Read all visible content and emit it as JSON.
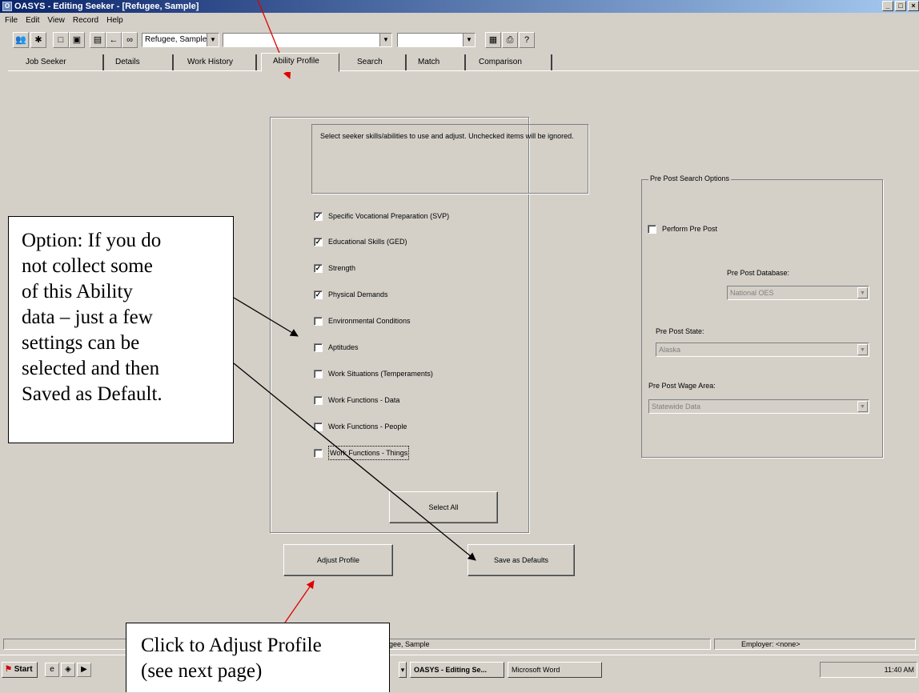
{
  "window": {
    "title": "OASYS - Editing Seeker - [Refugee, Sample]",
    "controls": [
      "_",
      "□",
      "×"
    ]
  },
  "menu": [
    "File",
    "Edit",
    "View",
    "Record",
    "Help"
  ],
  "toolbar": {
    "seeker_combo": "Refugee, Sample",
    "combo2": "",
    "combo3": ""
  },
  "tabs": [
    {
      "label": "Job Seeker"
    },
    {
      "label": "Details"
    },
    {
      "label": "Work History"
    },
    {
      "label": "Ability Profile"
    },
    {
      "label": "Search"
    },
    {
      "label": "Match"
    },
    {
      "label": "Comparison"
    }
  ],
  "instructions": "Select seeker skills/abilities to use and adjust.  Unchecked items will be ignored.",
  "checkboxes": [
    {
      "label": "Specific Vocational Preparation (SVP)",
      "checked": true
    },
    {
      "label": "Educational Skills (GED)",
      "checked": true
    },
    {
      "label": "Strength",
      "checked": true
    },
    {
      "label": "Physical Demands",
      "checked": true
    },
    {
      "label": "Environmental Conditions",
      "checked": false
    },
    {
      "label": "Aptitudes",
      "checked": false
    },
    {
      "label": "Work Situations (Temperaments)",
      "checked": false
    },
    {
      "label": "Work Functions - Data",
      "checked": false
    },
    {
      "label": "Work Functions - People",
      "checked": false
    },
    {
      "label": "Work Functions - Things",
      "checked": false
    }
  ],
  "buttons": {
    "select_all": "Select All",
    "adjust_profile": "Adjust Profile",
    "save_defaults": "Save as Defaults"
  },
  "prepost": {
    "group_label": "Pre Post Search Options",
    "perform_label": "Perform Pre Post",
    "perform_checked": false,
    "db_label": "Pre Post Database:",
    "db_value": "National OES",
    "state_label": "Pre Post State:",
    "state_value": "Alaska",
    "wage_label": "Pre Post Wage Area:",
    "wage_value": "Statewide Data"
  },
  "statusbar": {
    "pane1": "ker",
    "seeker": "Refugee, Sample",
    "employer": "Employer: <none>"
  },
  "taskbar": {
    "start": "Start",
    "item1": "OASYS - Editing Se...",
    "item2": "Microsoft Word",
    "clock": "11:40 AM"
  },
  "callouts": {
    "option_lines": [
      "Option:  If you do",
      "not collect some",
      "of this Ability",
      "data – just a few",
      "settings can be",
      "selected and then",
      "Saved as Default."
    ],
    "click_lines": [
      "Click to Adjust Profile",
      "(see next page)"
    ]
  },
  "colors": {
    "title_start": "#0a246a",
    "title_end": "#a6caf0",
    "arrow_red": "#e00000",
    "face": "#d4d0c8"
  }
}
